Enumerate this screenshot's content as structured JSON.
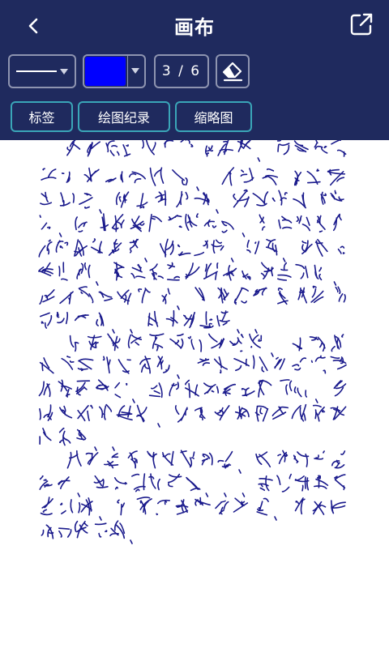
{
  "header": {
    "title": "画布",
    "back_icon": "chevron-left-icon",
    "share_icon": "share-icon"
  },
  "toolbar": {
    "line_style": "solid",
    "pen_color": "#0000ff",
    "page_counter": "3 / 6",
    "eraser_icon": "eraser-icon"
  },
  "tabs": [
    {
      "label": "标签"
    },
    {
      "label": "绘图纪录"
    },
    {
      "label": "缩略图"
    }
  ],
  "colors": {
    "toolbar_bg": "#1f2a5e",
    "tab_border": "#3aa6b8",
    "ink": "#1a1a8c"
  },
  "canvas": {
    "content": "handwritten-text",
    "lines": [
      "昨日的点滴浮现在眼前，第一次军",
      "训生活就此结束。总的来说还是",
      "很辛苦，但不知怎的，我却从心底喜",
      "欢。因为我未曾经历军训，总是听人说",
      "教官身份严格、不近人情。相反，我参加",
      "军训后，我们的教官是一个和蔼可亲、",
      "平时友善的教官，有时他也会和我们",
      "开玩笑啦……该不说他啦……",
      "教官推选我做优秀学员，说实话",
      "我既高兴又难过，高兴是教官他对我",
      "努力的肯定，难过的是我没有做到。我",
      "不配得此殊荣，因为我在训练时迟到",
      "了两次……",
      "教官说过这样一句话“过去的就过",
      "去了，未来还在继续”……我会永远铭",
      "记于心，珍重我的军训生活；珍重我",
      "敬爱的教官。"
    ]
  }
}
